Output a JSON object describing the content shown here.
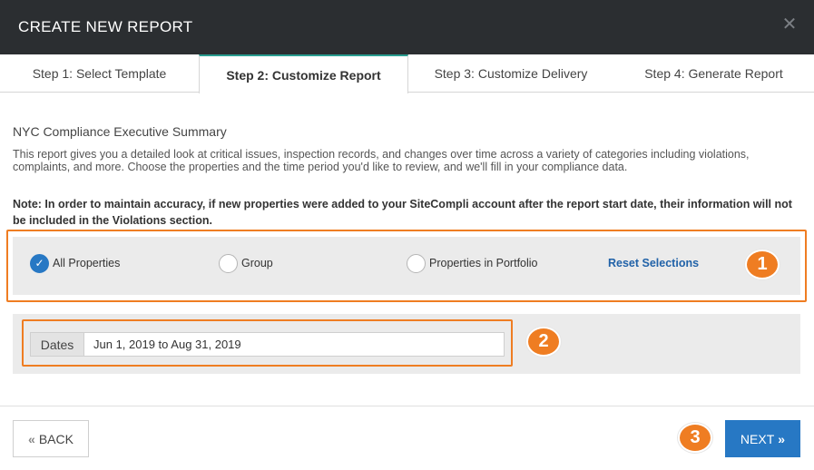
{
  "modal": {
    "title": "CREATE NEW REPORT",
    "close_icon": "close-icon"
  },
  "tabs": [
    {
      "label": "Step 1: Select Template",
      "active": false
    },
    {
      "label": "Step 2: Customize Report",
      "active": true
    },
    {
      "label": "Step 3: Customize Delivery",
      "active": false
    },
    {
      "label": "Step 4: Generate Report",
      "active": false
    }
  ],
  "report": {
    "title": "NYC Compliance Executive Summary",
    "description": "This report gives you a detailed look at critical issues, inspection records, and changes over time across a variety of categories including violations, complaints, and more. Choose the properties and the time period you'd like to review, and we'll fill in your compliance data.",
    "note": "Note: In order to maintain accuracy, if new properties were added to your SiteCompli account after the report start date, their information will not be included in the Violations section."
  },
  "properties": {
    "options": [
      {
        "label": "All Properties",
        "checked": true
      },
      {
        "label": "Group",
        "checked": false
      },
      {
        "label": "Properties in Portfolio",
        "checked": false
      }
    ],
    "reset_label": "Reset Selections"
  },
  "dates": {
    "label": "Dates",
    "value": "Jun 1, 2019 to Aug 31, 2019"
  },
  "footer": {
    "back_label": "BACK",
    "next_label": "NEXT"
  },
  "badges": [
    "1",
    "2",
    "3"
  ],
  "colors": {
    "header_bg": "#2b2e31",
    "accent_blue": "#2778c4",
    "highlight_orange": "#ef7d22",
    "panel_bg": "#ebebeb",
    "active_tab_top": "#2a9d8f"
  }
}
